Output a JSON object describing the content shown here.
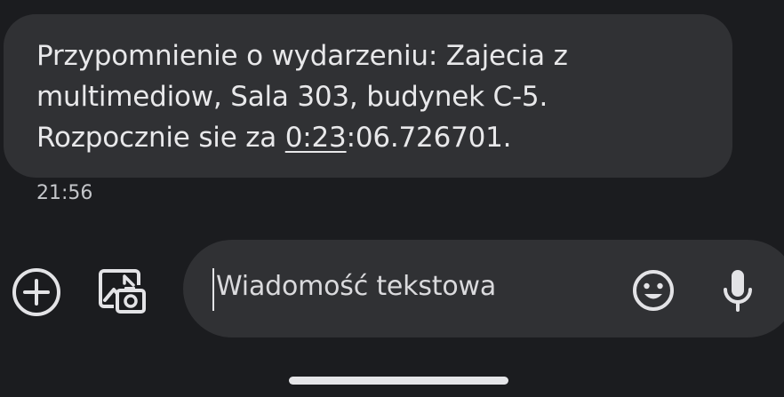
{
  "message": {
    "line1": "Przypomnienie o wydarzeniu: Zajecia z",
    "line2": "multimediow, Sala 303, budynek C-5.",
    "line3_prefix": "Rozpocznie sie za ",
    "line3_link": "0:23",
    "line3_suffix": ":06.726701.",
    "timestamp": "21:56"
  },
  "compose": {
    "placeholder": "Wiadomość tekstowa"
  },
  "icons": {
    "add": "add-circle-icon",
    "gallery": "gallery-camera-icon",
    "emoji": "emoji-icon",
    "mic": "microphone-icon"
  },
  "colors": {
    "background": "#1b1c1f",
    "bubble": "#303134",
    "text": "#e8e8ea",
    "secondary_text": "#c4c6ca"
  }
}
